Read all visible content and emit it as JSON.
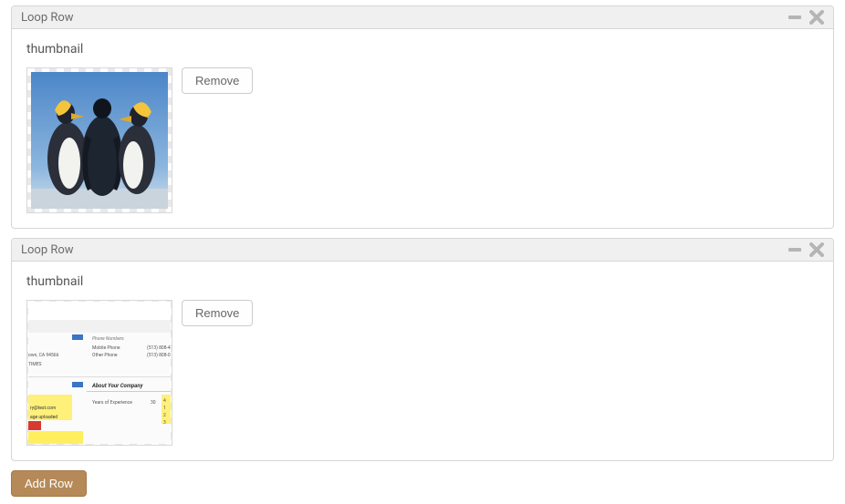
{
  "rows": [
    {
      "title": "Loop Row",
      "field_label": "thumbnail",
      "remove_label": "Remove",
      "image_kind": "penguins"
    },
    {
      "title": "Loop Row",
      "field_label": "thumbnail",
      "remove_label": "Remove",
      "image_kind": "form"
    }
  ],
  "add_row_label": "Add Row"
}
